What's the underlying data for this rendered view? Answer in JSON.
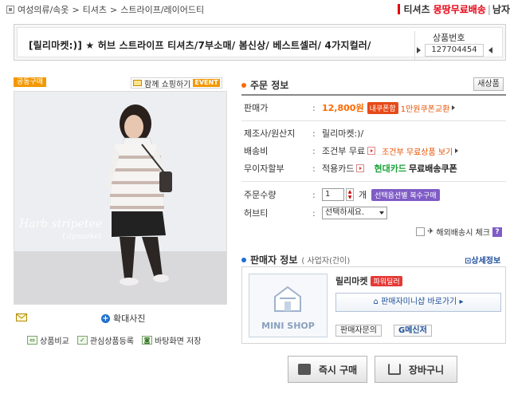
{
  "breadcrumb": {
    "items": [
      "여성의류/속옷",
      "티셔츠",
      "스트라이프/레이어드티"
    ],
    "separator": ">"
  },
  "promo": {
    "label": "티셔츠",
    "highlight": "몽땅무료배송",
    "tail": "남자",
    "accent_color": "#e60012"
  },
  "product": {
    "title": "[릴리마켓:)] ★ 허브 스트라이프 티셔츠/7부소매/ 봄신상/ 베스트셀러/ 4가지컬러/",
    "number_label": "상품번호",
    "number": "127704454"
  },
  "image_panel": {
    "group_badge": "공동구매",
    "share_label": "함께 쇼핑하기",
    "share_badge": "EVENT",
    "watermark": "Harb stripetee",
    "watermark_sub": "Lilymarket",
    "zoom_label": "확대사진",
    "tools": [
      "상품비교",
      "관심상품등록",
      "바탕화면 저장"
    ]
  },
  "order_info": {
    "heading": "주문 정보",
    "new_button": "새상품",
    "price_label": "판매가",
    "price": "12,800원",
    "coupon_badge": "내쿠폰함",
    "coupon_text": "1만원쿠폰교환",
    "maker_label": "제조사/원산지",
    "maker_value": "릴리마켓:)/",
    "shipping_label": "배송비",
    "shipping_value": "조건부 무료",
    "shipping_link": "조건부 무료상품 보기",
    "installment_label": "무이자할부",
    "installment_value": "적용카드",
    "card_name": "현대카드",
    "card_benefit": "무료배송쿠폰",
    "qty_label": "주문수량",
    "qty_value": "1",
    "qty_unit": "개",
    "multi_buy": "선택옵션별 복수구매",
    "option_label": "허브티",
    "option_value": "선택하세요.",
    "overseas_label": "해외배송시 체크",
    "overseas_help": "?",
    "price_color": "#ff6a00"
  },
  "seller_info": {
    "heading": "판매자 정보",
    "type": "( 사업자(간이)",
    "detail_link": "상세정보",
    "minishop_label": "MINI SHOP",
    "seller_name": "릴리마켓",
    "power_badge": "파워딜러",
    "minishop_button": "판매자미니샵 바로가기",
    "inquiry_button": "판매자문의",
    "messenger_button": "G메신저"
  },
  "actions": {
    "buy_now": "즉시 구매",
    "cart": "장바구니"
  }
}
